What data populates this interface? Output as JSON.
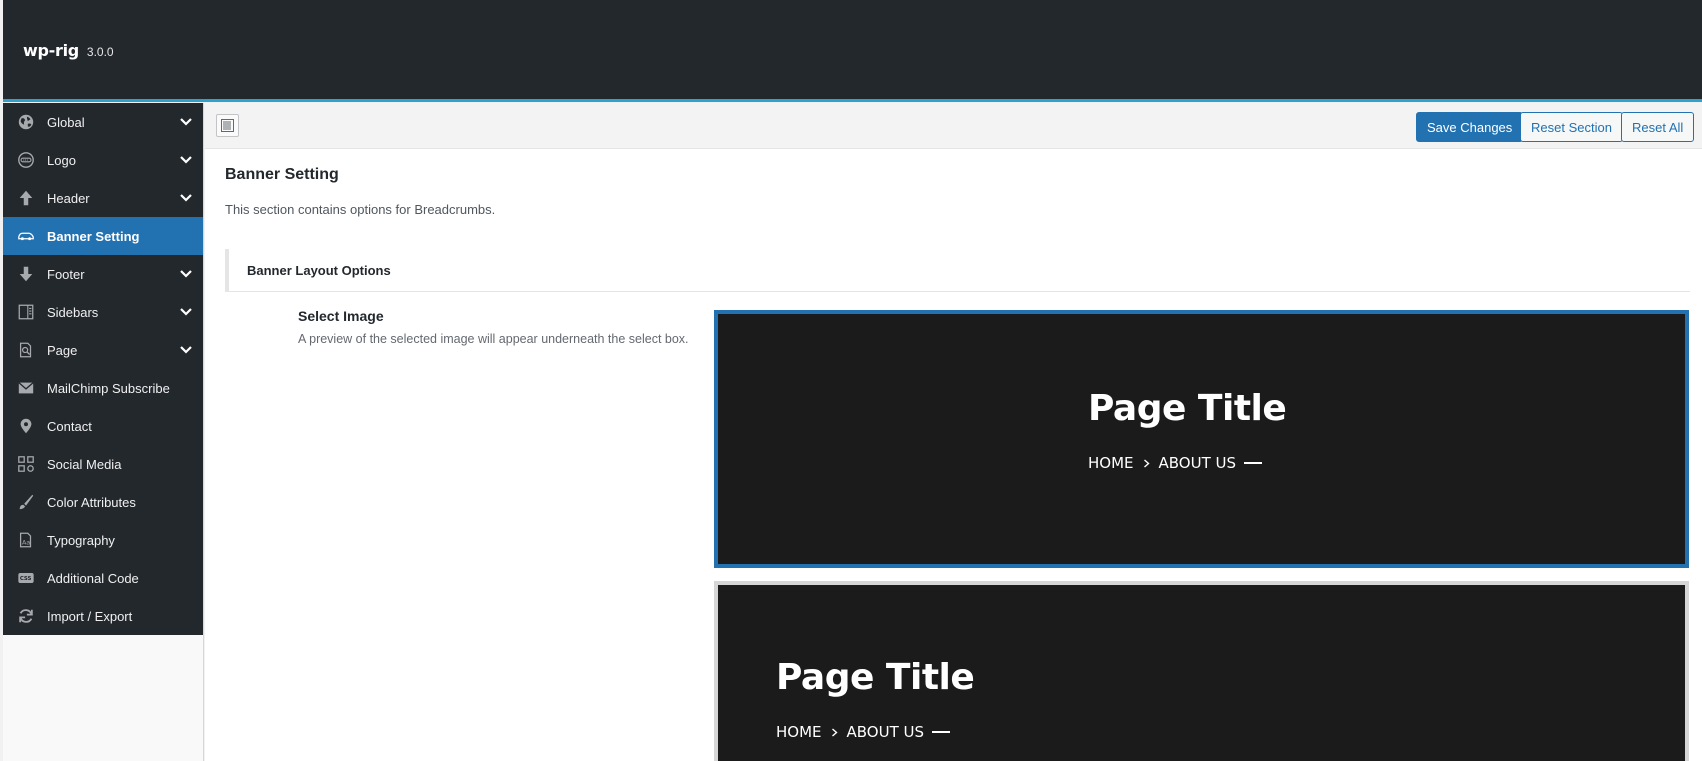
{
  "app": {
    "name": "wp-rig",
    "version": "3.0.0"
  },
  "sidebar": {
    "items": [
      {
        "label": "Global",
        "icon": "globe-icon",
        "has_children": true,
        "active": false
      },
      {
        "label": "Logo",
        "icon": "logo-icon",
        "has_children": true,
        "active": false
      },
      {
        "label": "Header",
        "icon": "arrow-up-icon",
        "has_children": true,
        "active": false
      },
      {
        "label": "Banner Setting",
        "icon": "car-icon",
        "has_children": false,
        "active": true
      },
      {
        "label": "Footer",
        "icon": "arrow-down-icon",
        "has_children": true,
        "active": false
      },
      {
        "label": "Sidebars",
        "icon": "layout-icon",
        "has_children": true,
        "active": false
      },
      {
        "label": "Page",
        "icon": "page-search-icon",
        "has_children": true,
        "active": false
      },
      {
        "label": "MailChimp Subscribe",
        "icon": "email-icon",
        "has_children": false,
        "active": false
      },
      {
        "label": "Contact",
        "icon": "location-pin-icon",
        "has_children": false,
        "active": false
      },
      {
        "label": "Social Media",
        "icon": "qr-code-icon",
        "has_children": false,
        "active": false
      },
      {
        "label": "Color Attributes",
        "icon": "brush-icon",
        "has_children": false,
        "active": false
      },
      {
        "label": "Typography",
        "icon": "typography-icon",
        "has_children": false,
        "active": false
      },
      {
        "label": "Additional Code",
        "icon": "css-icon",
        "has_children": false,
        "active": false
      },
      {
        "label": "Import / Export",
        "icon": "refresh-icon",
        "has_children": false,
        "active": false
      }
    ]
  },
  "toolbar": {
    "save_label": "Save Changes",
    "reset_section_label": "Reset Section",
    "reset_all_label": "Reset All"
  },
  "section": {
    "title": "Banner Setting",
    "description": "This section contains options for Breadcrumbs.",
    "subsection_title": "Banner Layout Options"
  },
  "field": {
    "label": "Select Image",
    "description": "A preview of the selected image will appear underneath the select box."
  },
  "previews": [
    {
      "title": "Page Title",
      "crumb_home": "HOME",
      "crumb_current": "ABOUT US",
      "alignment": "center",
      "selected": true
    },
    {
      "title": "Page Title",
      "crumb_home": "HOME",
      "crumb_current": "ABOUT US",
      "alignment": "left",
      "selected": false
    }
  ],
  "colors": {
    "admin_dark": "#23282d",
    "accent_blue": "#2271b1",
    "highlight_line": "#2ea2cc",
    "preview_bg": "#1b1b1b"
  }
}
